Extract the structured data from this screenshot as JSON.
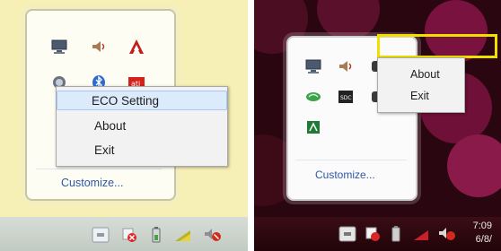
{
  "left_panel": {
    "context_menu": {
      "items": [
        {
          "label": "ECO Setting",
          "highlighted": true
        },
        {
          "label": "About",
          "highlighted": false
        },
        {
          "label": "Exit",
          "highlighted": false
        }
      ]
    },
    "customize_link": "Customize..."
  },
  "right_panel": {
    "context_menu": {
      "items": [
        {
          "label": "About"
        },
        {
          "label": "Exit"
        }
      ]
    },
    "customize_link": "Customize...",
    "clock": {
      "time": "7:09",
      "date": "6/8/"
    }
  },
  "colors": {
    "highlight_box": "#f0e000",
    "link": "#2f57a6",
    "menu_highlight": "#dcebfb"
  },
  "icons": [
    "network-icon",
    "speaker-icon",
    "amd-catalyst-icon",
    "power-icon",
    "bluetooth-icon",
    "ati-icon",
    "eco-icon",
    "sd-card-icon",
    "acrobat-icon",
    "flag-icon",
    "battery-icon",
    "warning-icon",
    "volume-muted-icon"
  ]
}
